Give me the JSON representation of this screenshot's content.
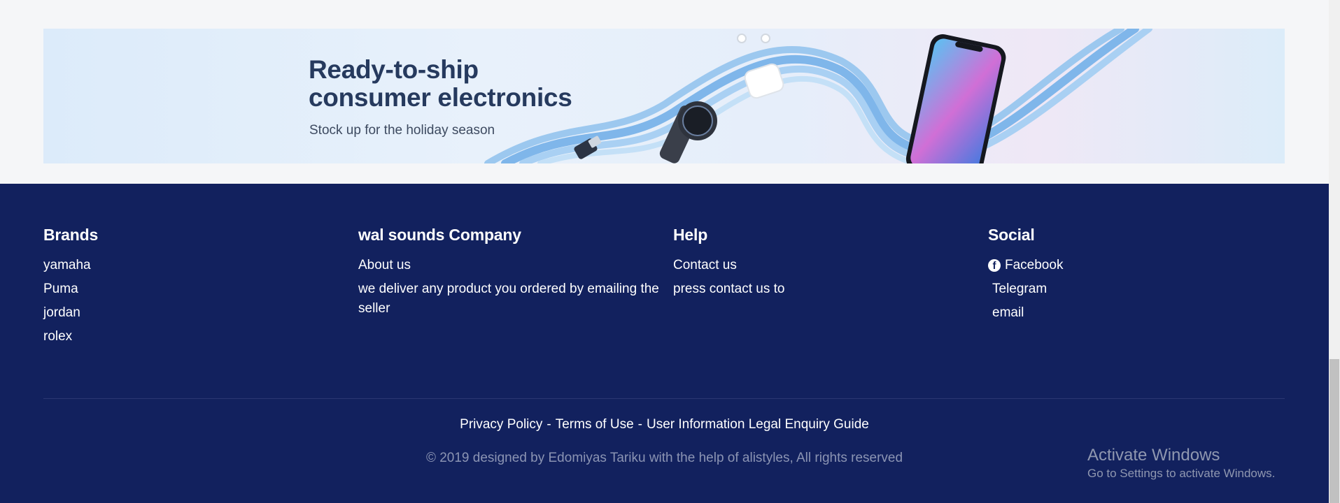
{
  "banner": {
    "title_line1": "Ready-to-ship",
    "title_line2": "consumer electronics",
    "subtitle": "Stock up for the holiday season"
  },
  "footer": {
    "brands": {
      "heading": "Brands",
      "items": [
        "yamaha",
        "Puma",
        "jordan",
        "rolex"
      ]
    },
    "company": {
      "heading": "wal sounds Company",
      "about": "About us",
      "description": "we deliver any product you ordered by emailing the seller"
    },
    "help": {
      "heading": "Help",
      "contact": "Contact us",
      "press": "press contact us to"
    },
    "social": {
      "heading": "Social",
      "items": [
        {
          "label": "Facebook",
          "icon": "facebook-icon"
        },
        {
          "label": "Telegram",
          "icon": ""
        },
        {
          "label": "email",
          "icon": ""
        }
      ]
    },
    "legal": {
      "privacy": "Privacy Policy",
      "separator": "-",
      "terms": "Terms of Use",
      "user_info": "User Information Legal Enquiry Guide"
    },
    "copyright": "© 2019 designed by Edomiyas Tariku with the help of alistyles, All rights reserved"
  },
  "watermark": {
    "title": "Activate Windows",
    "subtitle": "Go to Settings to activate Windows."
  },
  "colors": {
    "page_bg": "#f5f6f8",
    "footer_bg": "#12215e",
    "banner_title": "#263a5e",
    "copyright_text": "#8b94b3"
  }
}
